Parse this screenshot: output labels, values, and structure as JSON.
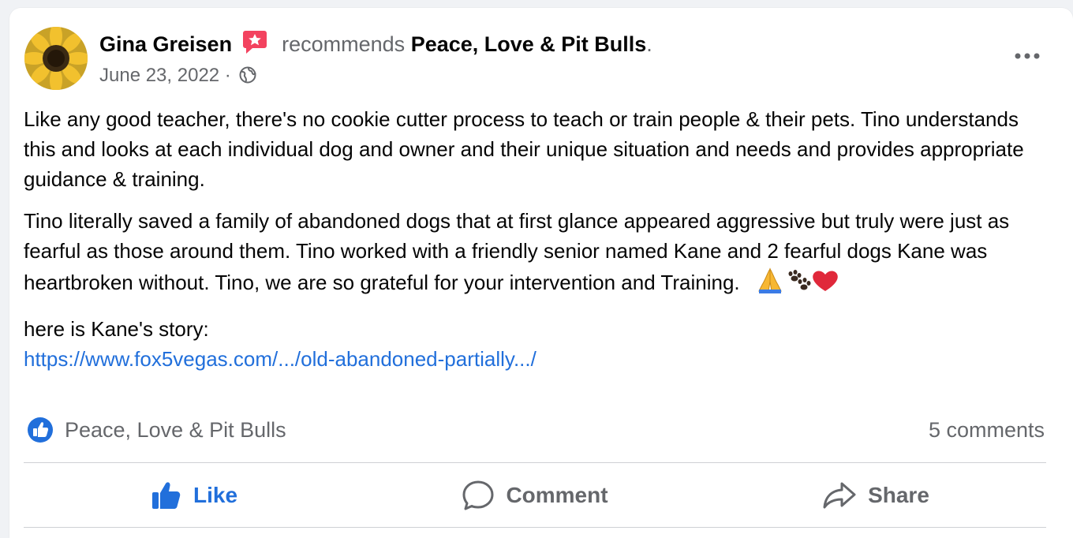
{
  "post": {
    "author": "Gina Greisen",
    "recommends": "recommends",
    "page_name": "Peace, Love & Pit Bulls",
    "page_period": ".",
    "date": "June 23, 2022",
    "separator": " · ",
    "privacy_icon": "globe-icon",
    "paragraphs": [
      "Like any good teacher,  there's no cookie cutter process to teach or train people & their pets. Tino understands this and looks at each individual dog and owner and their unique situation and needs and provides appropriate guidance & training.",
      "Tino literally saved a family of abandoned dogs that at first glance appeared aggressive but truly were just as fearful as those around them.  Tino worked with a friendly senior named Kane and 2 fearful dogs Kane was heartbroken without.  Tino, we are so grateful for your intervention and Training."
    ],
    "story_intro": "here is Kane's story:",
    "link": "https://www.fox5vegas.com/.../old-abandoned-partially.../"
  },
  "stats": {
    "recommended_by": "Peace, Love & Pit Bulls",
    "comments": "5 comments"
  },
  "actions": {
    "like": "Like",
    "comment": "Comment",
    "share": "Share"
  },
  "colors": {
    "accent": "#216fdb",
    "badge_pink": "#f3425f",
    "muted_text": "#65676b"
  }
}
